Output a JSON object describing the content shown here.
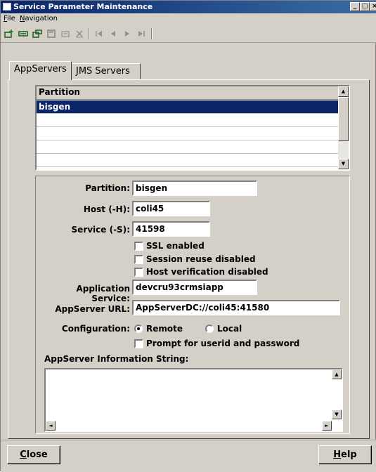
{
  "window": {
    "title": "Service Parameter Maintenance"
  },
  "menu": {
    "file": "File",
    "file_underline": "F",
    "file_rest": "ile",
    "navigation": "Navigation",
    "nav_underline": "N",
    "nav_rest": "avigation"
  },
  "toolbar": {
    "icons": [
      "new-icon",
      "delete-icon",
      "copy-icon",
      "save-icon",
      "refresh-icon",
      "cancel-icon",
      "first-icon",
      "previous-icon",
      "next-icon",
      "last-icon"
    ]
  },
  "tabs": [
    {
      "label": "AppServers",
      "active": true
    },
    {
      "label": "JMS Servers",
      "active": false
    }
  ],
  "partition_list": {
    "header": "Partition",
    "rows": [
      "bisgen",
      "",
      "",
      "",
      ""
    ],
    "selected_index": 0
  },
  "form": {
    "partition_label": "Partition:",
    "partition_value": "bisgen",
    "host_label": "Host (-H):",
    "host_value": "coli45",
    "service_label": "Service (-S):",
    "service_value": "41598",
    "ssl_label": "SSL enabled",
    "session_reuse_label": "Session reuse disabled",
    "host_verification_label": "Host verification disabled",
    "app_service_label": "Application Service:",
    "app_service_value": "devcru93crmsiapp",
    "appserver_url_label": "AppServer URL:",
    "appserver_url_value": "AppServerDC://coli45:41580",
    "configuration_label": "Configuration:",
    "remote_label": "Remote",
    "local_label": "Local",
    "configuration_selected": "Remote",
    "prompt_label": "Prompt for userid and password",
    "info_string_label": "AppServer Information String:",
    "info_string_value": ""
  },
  "buttons": {
    "close_u": "C",
    "close_rest": "lose",
    "help_u": "H",
    "help_rest": "elp"
  },
  "colors": {
    "selection": "#0a246a",
    "title_bar": "#0a246a",
    "face": "#d4d0c8"
  }
}
